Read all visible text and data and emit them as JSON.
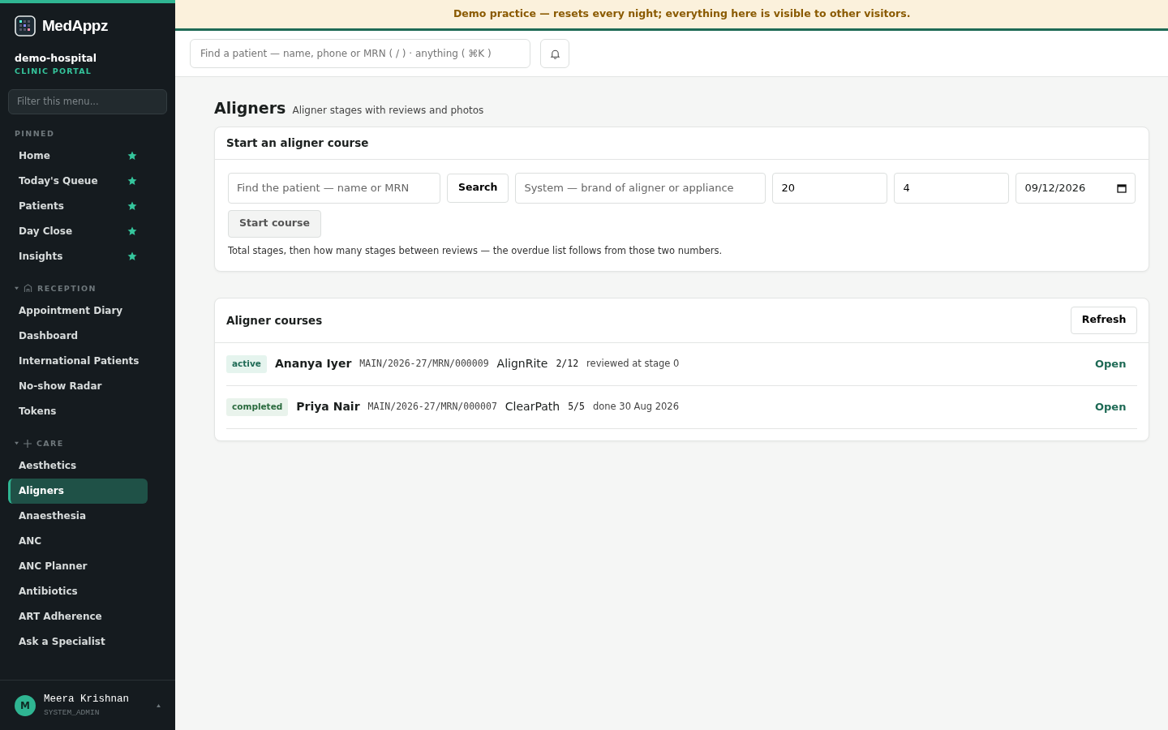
{
  "brand": {
    "name": "MedAppz",
    "org": "demo-hospital",
    "portal": "CLINIC PORTAL"
  },
  "sidebar": {
    "filter_placeholder": "Filter this menu...",
    "sections": [
      {
        "title": "PINNED",
        "kind": "pinned",
        "items": [
          {
            "label": "Home",
            "pinned": true,
            "selected": false
          },
          {
            "label": "Today's Queue",
            "pinned": true,
            "selected": false
          },
          {
            "label": "Patients",
            "pinned": true,
            "selected": false
          },
          {
            "label": "Day Close",
            "pinned": true,
            "selected": false
          },
          {
            "label": "Insights",
            "pinned": true,
            "selected": false
          }
        ]
      },
      {
        "title": "RECEPTION",
        "kind": "reception",
        "expanded": true,
        "items": [
          {
            "label": "Appointment Diary",
            "selected": false
          },
          {
            "label": "Dashboard",
            "selected": false
          },
          {
            "label": "International Patients",
            "selected": false
          },
          {
            "label": "No-show Radar",
            "selected": false
          },
          {
            "label": "Tokens",
            "selected": false
          }
        ]
      },
      {
        "title": "CARE",
        "kind": "care",
        "expanded": true,
        "items": [
          {
            "label": "Aesthetics",
            "selected": false
          },
          {
            "label": "Aligners",
            "selected": true
          },
          {
            "label": "Anaesthesia",
            "selected": false
          },
          {
            "label": "ANC",
            "selected": false
          },
          {
            "label": "ANC Planner",
            "selected": false
          },
          {
            "label": "Antibiotics",
            "selected": false
          },
          {
            "label": "ART Adherence",
            "selected": false
          },
          {
            "label": "Ask a Specialist",
            "selected": false
          }
        ]
      }
    ]
  },
  "user": {
    "initial": "M",
    "name": "Meera Krishnan",
    "role": "SYSTEM_ADMIN"
  },
  "banner": "Demo practice — resets every night; everything here is visible to other visitors.",
  "search": {
    "placeholder": "Find a patient — name, phone or MRN ( / ) · anything ( ⌘K )"
  },
  "page": {
    "title": "Aligners",
    "subtitle": "Aligner stages with reviews and photos"
  },
  "start_form": {
    "title": "Start an aligner course",
    "patient_placeholder": "Find the patient — name or MRN",
    "search_button": "Search",
    "system_placeholder": "System — brand of aligner or appliance",
    "total_stages": "20",
    "review_every": "4",
    "start_date": "09/12/2026",
    "submit": "Start course",
    "hint": "Total stages, then how many stages between reviews — the overdue list follows from those two numbers."
  },
  "courses": {
    "title": "Aligner courses",
    "refresh": "Refresh",
    "rows": [
      {
        "status": "active",
        "patient": "Ananya Iyer",
        "mrn": "MAIN/2026-27/MRN/000009",
        "system": "AlignRite",
        "progress": "2/12",
        "note": "reviewed at stage 0",
        "action": "Open"
      },
      {
        "status": "completed",
        "patient": "Priya Nair",
        "mrn": "MAIN/2026-27/MRN/000007",
        "system": "ClearPath",
        "progress": "5/5",
        "note": "done 30 Aug 2026",
        "action": "Open"
      }
    ]
  }
}
